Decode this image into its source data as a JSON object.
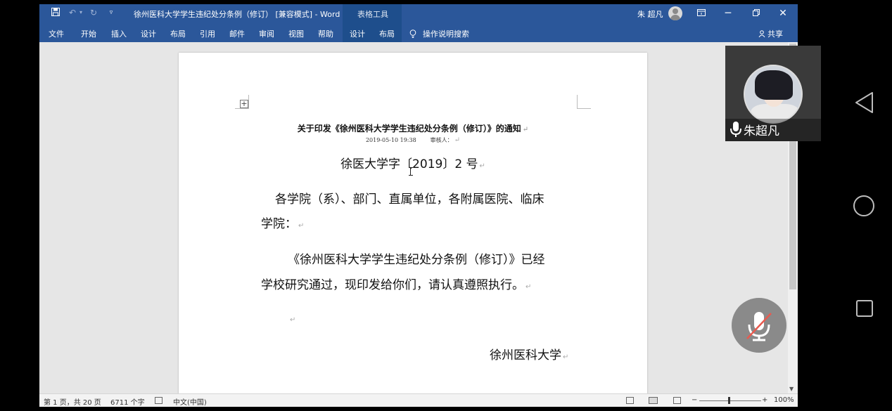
{
  "window": {
    "title": "徐州医科大学学生违纪处分条例（修订） [兼容模式] - Word",
    "context_tab_group": "表格工具",
    "user_name": "朱 超凡"
  },
  "ribbon": {
    "tabs": [
      "文件",
      "开始",
      "插入",
      "设计",
      "布局",
      "引用",
      "邮件",
      "审阅",
      "视图",
      "帮助",
      "设计",
      "布局"
    ],
    "tell_me": "操作说明搜索",
    "share": "共享"
  },
  "document": {
    "title": "关于印发《徐州医科大学学生违纪处分条例（修订）》的通知",
    "meta_date": "2019-05-10 19:38",
    "meta_reviewer": "审核人：",
    "doc_number": "徐医大学字〔2019〕2 号",
    "addressee_line1": "各学院（系）、部门、直属单位，各附属医院、临床",
    "addressee_line2": "学院：",
    "body_line1": "《徐州医科大学学生违纪处分条例（修订）》已经",
    "body_line2": "学校研究通过，现印发给你们，请认真遵照执行。",
    "signature": "徐州医科大学",
    "para_mark": "↵"
  },
  "statusbar": {
    "page": "第 1 页，共 20 页",
    "words": "6711 个字",
    "language": "中文(中国)",
    "zoom_minus": "−",
    "zoom_plus": "+",
    "zoom": "100%",
    "zoom_level": 1.0
  },
  "video_call": {
    "participant_name": "朱超凡"
  },
  "colors": {
    "word_blue": "#2b579a",
    "context_tab": "#1e4e8c"
  }
}
